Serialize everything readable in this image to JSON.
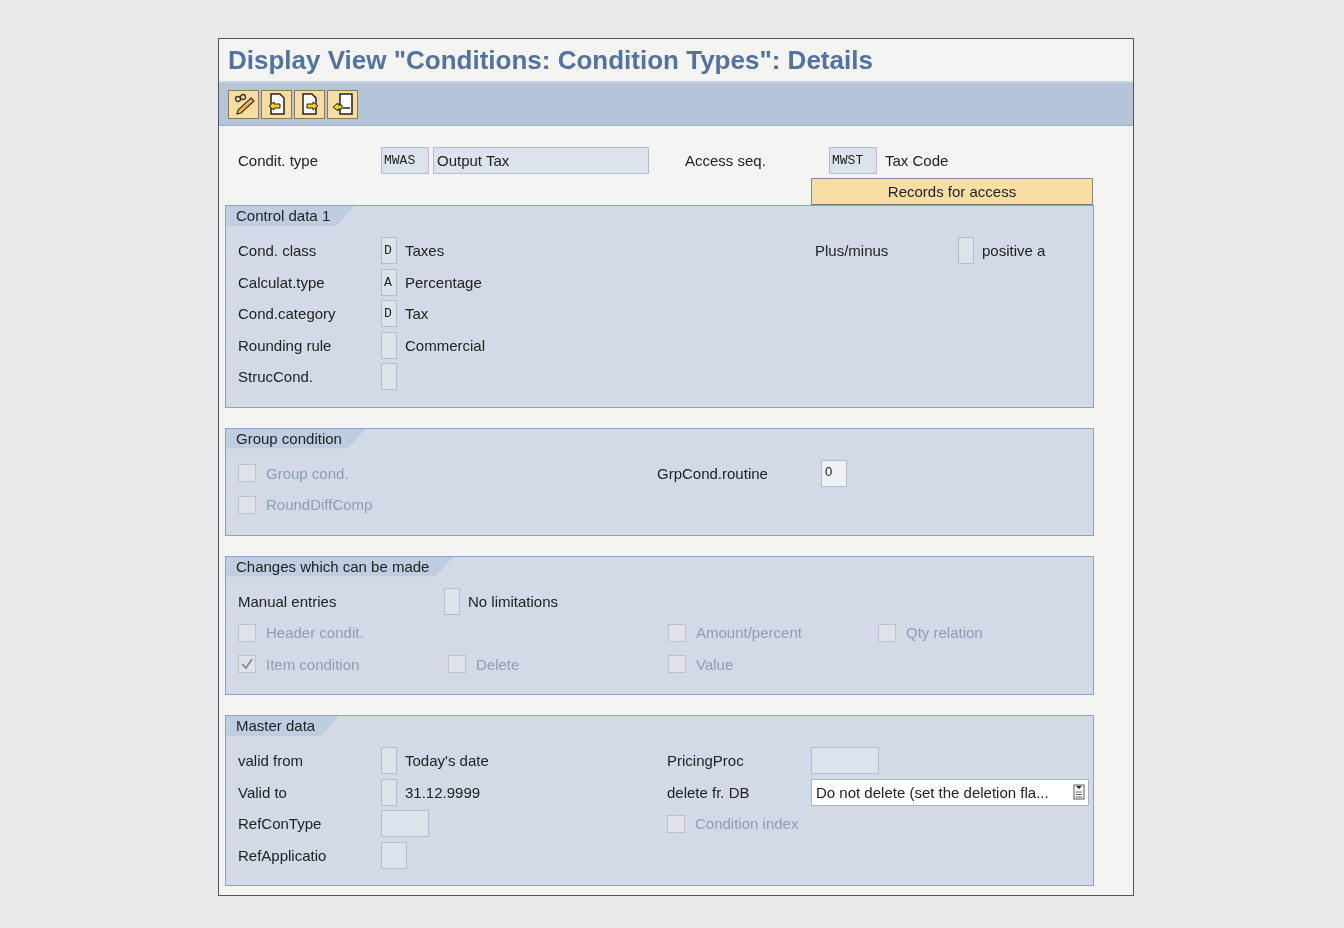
{
  "window": {
    "title": "Display View \"Conditions: Condition Types\": Details"
  },
  "header": {
    "condition_type": {
      "label": "Condit. type",
      "code": "MWAS",
      "description": "Output Tax"
    },
    "access_sequence": {
      "label": "Access seq.",
      "code": "MWST",
      "description": "Tax Code"
    },
    "records_button": "Records for access"
  },
  "control_data": {
    "title": "Control data 1",
    "fields": [
      {
        "label": "Cond. class",
        "code": "D",
        "value": "Taxes"
      },
      {
        "label": "Calculat.type",
        "code": "A",
        "value": "Percentage"
      },
      {
        "label": "Cond.category",
        "code": "D",
        "value": "Tax"
      },
      {
        "label": "Rounding rule",
        "value": "Commercial"
      },
      {
        "label": "StrucCond."
      }
    ],
    "plus_minus": {
      "label": "Plus/minus",
      "value": "positive a"
    }
  },
  "group_condition": {
    "title": "Group condition",
    "checkboxes": [
      {
        "label": "Group cond.",
        "checked": false,
        "disabled": true
      },
      {
        "label": "RoundDiffComp",
        "checked": false,
        "disabled": true
      }
    ],
    "routine": {
      "label": "GrpCond.routine",
      "value": "0"
    }
  },
  "changes": {
    "title": "Changes which can be made",
    "manual_entries": {
      "label": "Manual entries",
      "value": "No limitations"
    },
    "checkboxes": [
      {
        "label": "Header condit.",
        "checked": false,
        "disabled": true
      },
      {
        "label": "Amount/percent",
        "checked": false,
        "disabled": true
      },
      {
        "label": "Qty relation",
        "checked": false,
        "disabled": true
      },
      {
        "label": "Item condition",
        "checked": true,
        "disabled": true
      },
      {
        "label": "Delete",
        "checked": false,
        "disabled": true
      },
      {
        "label": "Value",
        "checked": false,
        "disabled": true
      }
    ]
  },
  "master_data": {
    "title": "Master data",
    "valid_from": {
      "label": "valid from",
      "value": "Today's date"
    },
    "valid_to": {
      "label": "Valid to",
      "value": "31.12.9999"
    },
    "ref_con_type": {
      "label": "RefConType"
    },
    "ref_application": {
      "label": "RefApplicatio"
    },
    "pricing_proc": {
      "label": "PricingProc"
    },
    "delete_db": {
      "label": "delete fr. DB",
      "value": "Do not delete (set the deletion fla..."
    },
    "condition_index": {
      "label": "Condition index",
      "checked": false,
      "disabled": true
    }
  }
}
